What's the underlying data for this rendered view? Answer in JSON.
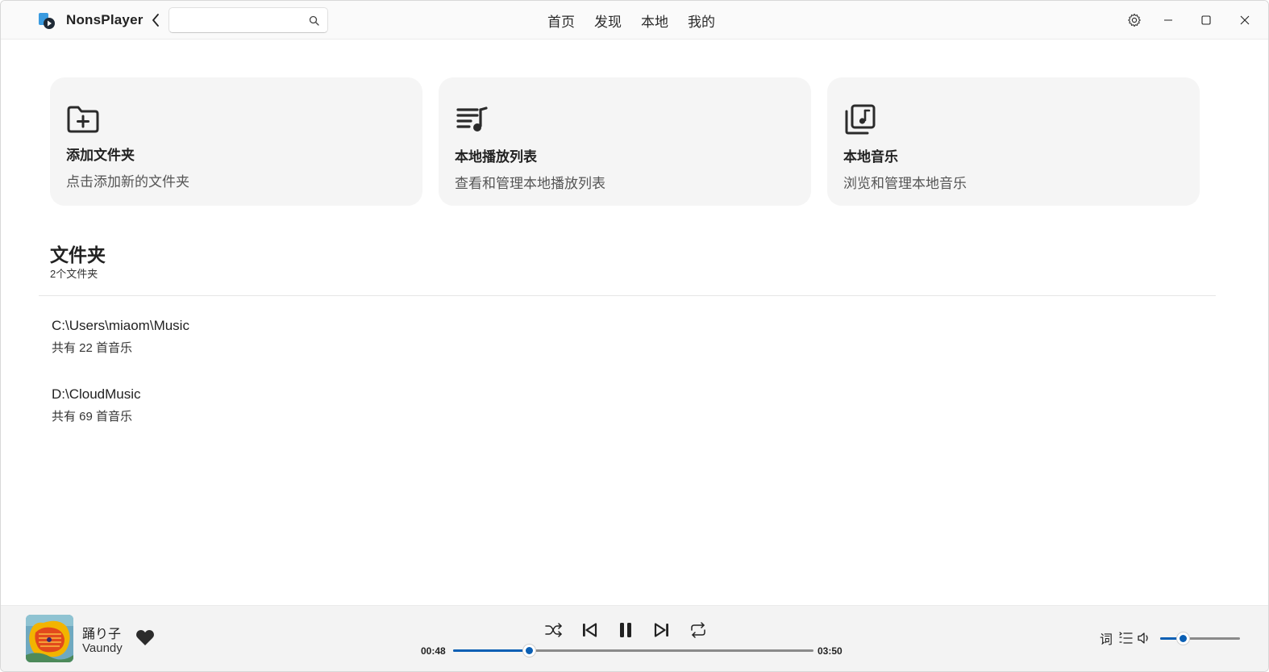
{
  "app": {
    "name": "NonsPlayer",
    "search_placeholder": ""
  },
  "nav": {
    "items": [
      "首页",
      "发现",
      "本地",
      "我的"
    ]
  },
  "cards": [
    {
      "icon": "folder-add-icon",
      "title": "添加文件夹",
      "desc": "点击添加新的文件夹"
    },
    {
      "icon": "playlist-icon",
      "title": "本地播放列表",
      "desc": "查看和管理本地播放列表"
    },
    {
      "icon": "music-library-icon",
      "title": "本地音乐",
      "desc": "浏览和管理本地音乐"
    }
  ],
  "folders_section": {
    "title": "文件夹",
    "count": "2个文件夹",
    "items": [
      {
        "path": "C:\\Users\\miaom\\Music",
        "count": "共有 22 首音乐"
      },
      {
        "path": "D:\\CloudMusic",
        "count": "共有 69 首音乐"
      }
    ]
  },
  "player": {
    "title": "踊り子",
    "artist": "Vaundy",
    "time_current": "00:48",
    "time_total": "03:50",
    "progress": 0.21,
    "volume": 0.28,
    "lyrics_label": "词"
  },
  "colors": {
    "accent": "#0a5fb4",
    "card_bg": "#f5f5f5",
    "player_bg": "#f3f3f3"
  }
}
